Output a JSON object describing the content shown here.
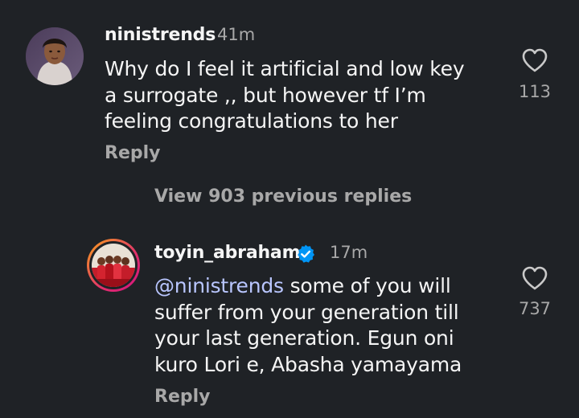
{
  "comments": [
    {
      "username": "ninistrends",
      "time": "41m",
      "text_lines": [
        "Why do I feel it artificial and low key",
        "a surrogate ,, but however tf I’m",
        "feeling congratulations to her"
      ],
      "likes": "113",
      "reply_label": "Reply"
    },
    {
      "username": "toyin_abraham",
      "verified": true,
      "time": "17m",
      "mention": "@ninistrends",
      "text_first_rest": " some of you will",
      "text_lines": [
        "suffer from your generation till",
        "your last generation. Egun oni",
        "kuro Lori e, Abasha yamayama"
      ],
      "likes": "737",
      "reply_label": "Reply"
    }
  ],
  "view_replies_label": "View 903 previous replies",
  "colors": {
    "background": "#1f2226",
    "text": "#f5f5f5",
    "muted": "#a8a8a8",
    "mention": "#b9c6ff",
    "verified": "#0095f6",
    "story_ring_start": "#f9a31b",
    "story_ring_end": "#d3127f"
  },
  "icons": [
    "heart-outline-icon",
    "verified-badge-icon"
  ]
}
